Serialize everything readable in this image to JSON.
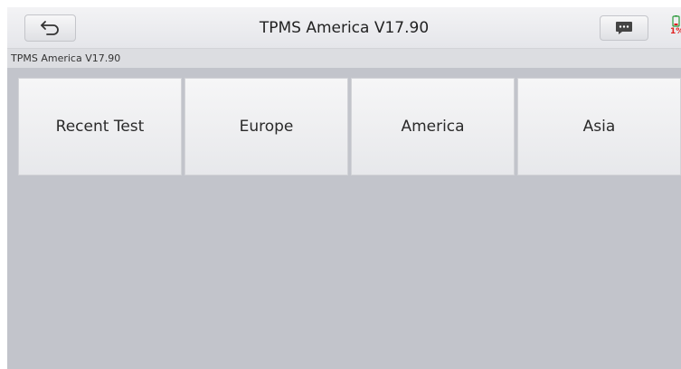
{
  "header": {
    "title": "TPMS America V17.90",
    "back_icon": "back-arrow-icon",
    "message_icon": "chat-bubble-icon",
    "battery_percent": "1%"
  },
  "breadcrumb": "TPMS America V17.90",
  "menu": {
    "items": [
      {
        "label": "Recent Test"
      },
      {
        "label": "Europe"
      },
      {
        "label": "America"
      },
      {
        "label": "Asia"
      }
    ]
  },
  "colors": {
    "background": "#c2c4cb",
    "tile": "#eeeff1",
    "battery_low": "#e02020"
  }
}
